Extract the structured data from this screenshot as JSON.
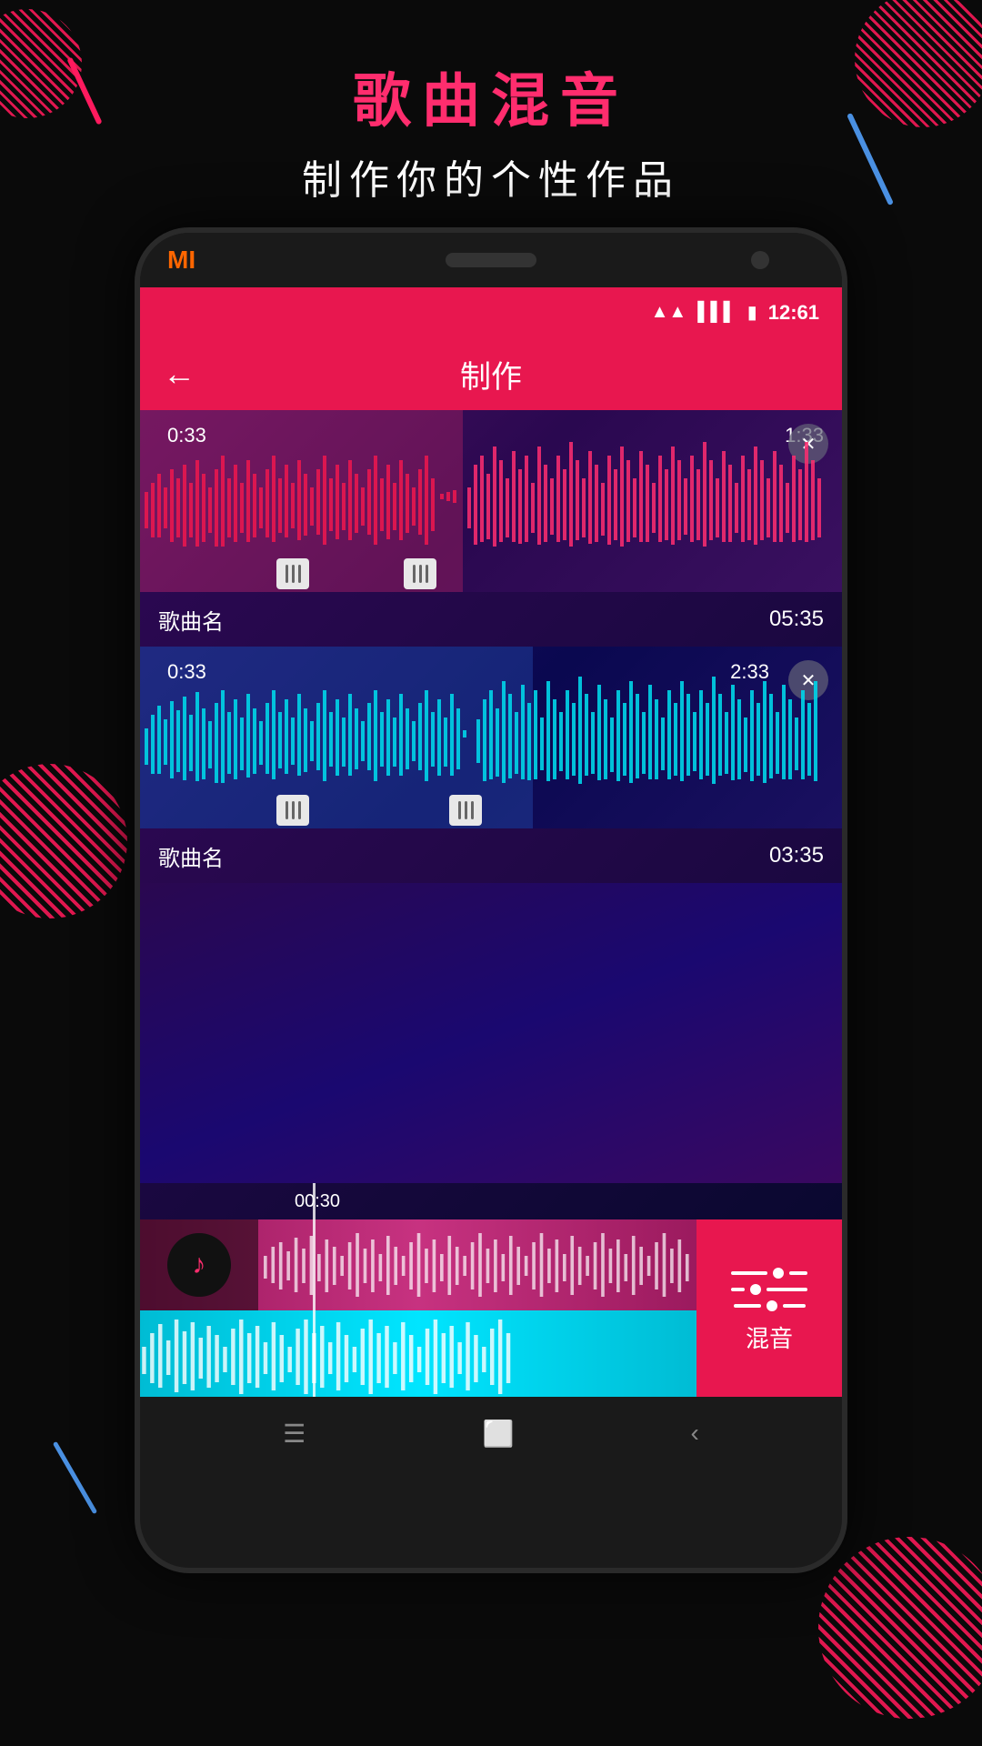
{
  "title": {
    "main": "歌曲混音",
    "sub": "制作你的个性作品"
  },
  "header": {
    "brand": "MI",
    "status": {
      "time": "12:61",
      "wifi_icon": "📶",
      "signal_icon": "📶",
      "battery_icon": "🔋"
    },
    "back_label": "←",
    "page_title": "制作"
  },
  "tracks": [
    {
      "id": "track1",
      "name": "歌曲名",
      "duration": "05:35",
      "time_start": "0:33",
      "time_end": "1:33",
      "color": "pink"
    },
    {
      "id": "track2",
      "name": "歌曲名",
      "duration": "03:35",
      "time_start": "0:33",
      "time_end": "2:33",
      "color": "cyan"
    }
  ],
  "timeline": {
    "marker": "00:30"
  },
  "mix_button": {
    "label": "混音"
  },
  "nav": {
    "menu_icon": "☰",
    "home_icon": "⬜",
    "back_icon": "‹"
  }
}
